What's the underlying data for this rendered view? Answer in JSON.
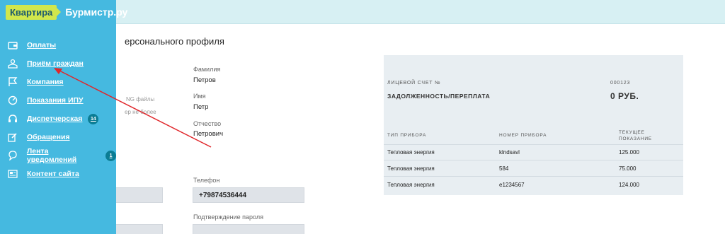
{
  "brand": {
    "logo_box": "Квартира",
    "logo_text": "Бурмистр.ру"
  },
  "nav": [
    {
      "label": "Оплаты",
      "icon": "wallet-icon"
    },
    {
      "label": "Приём граждан",
      "icon": "reception-icon"
    },
    {
      "label": "Компания",
      "icon": "flag-icon"
    },
    {
      "label": "Показания ИПУ",
      "icon": "meter-icon"
    },
    {
      "label": "Диспетчерская",
      "icon": "dispatch-icon",
      "badge": "14"
    },
    {
      "label": "Обращения",
      "icon": "edit-icon"
    },
    {
      "label": "Лента уведомлений",
      "icon": "notification-icon",
      "badge": "1"
    },
    {
      "label": "Контент сайта",
      "icon": "content-icon"
    }
  ],
  "profile": {
    "title": "ерсонального профиля",
    "faded_1": "NG файлы",
    "faded_2": "ер не более",
    "surname_label": "Фамилия",
    "surname_value": "Петров",
    "name_label": "Имя",
    "name_value": "Петр",
    "patronymic_label": "Отчество",
    "patronymic_value": "Петрович",
    "phone_label": "Телефон",
    "phone_value": "+79874536444",
    "password_confirm_label": "Подтверждение пароля"
  },
  "account": {
    "account_label": "ЛИЦЕВОЙ СЧЕТ №",
    "account_number": "000123",
    "debt_label": "ЗАДОЛЖЕННОСТЬ/ПЕРЕПЛАТА",
    "debt_value": "0 РУБ.",
    "columns": [
      "ТИП ПРИБОРА",
      "НОМЕР ПРИБОРА",
      "ТЕКУЩЕЕ",
      "ПОКАЗАНИЕ"
    ],
    "rows": [
      {
        "type": "Тепловая энергия",
        "number": "klndsavl",
        "reading": "125.000"
      },
      {
        "type": "Тепловая энергия",
        "number": "584",
        "reading": "75.000"
      },
      {
        "type": "Тепловая энергия",
        "number": "e1234567",
        "reading": "124.000"
      }
    ]
  },
  "colors": {
    "sidebar": "#45b9e0",
    "topbar": "#d7f0f3",
    "logo_accent": "#d1e74c",
    "badge": "#0b7d94",
    "arrow": "#e0262a"
  }
}
